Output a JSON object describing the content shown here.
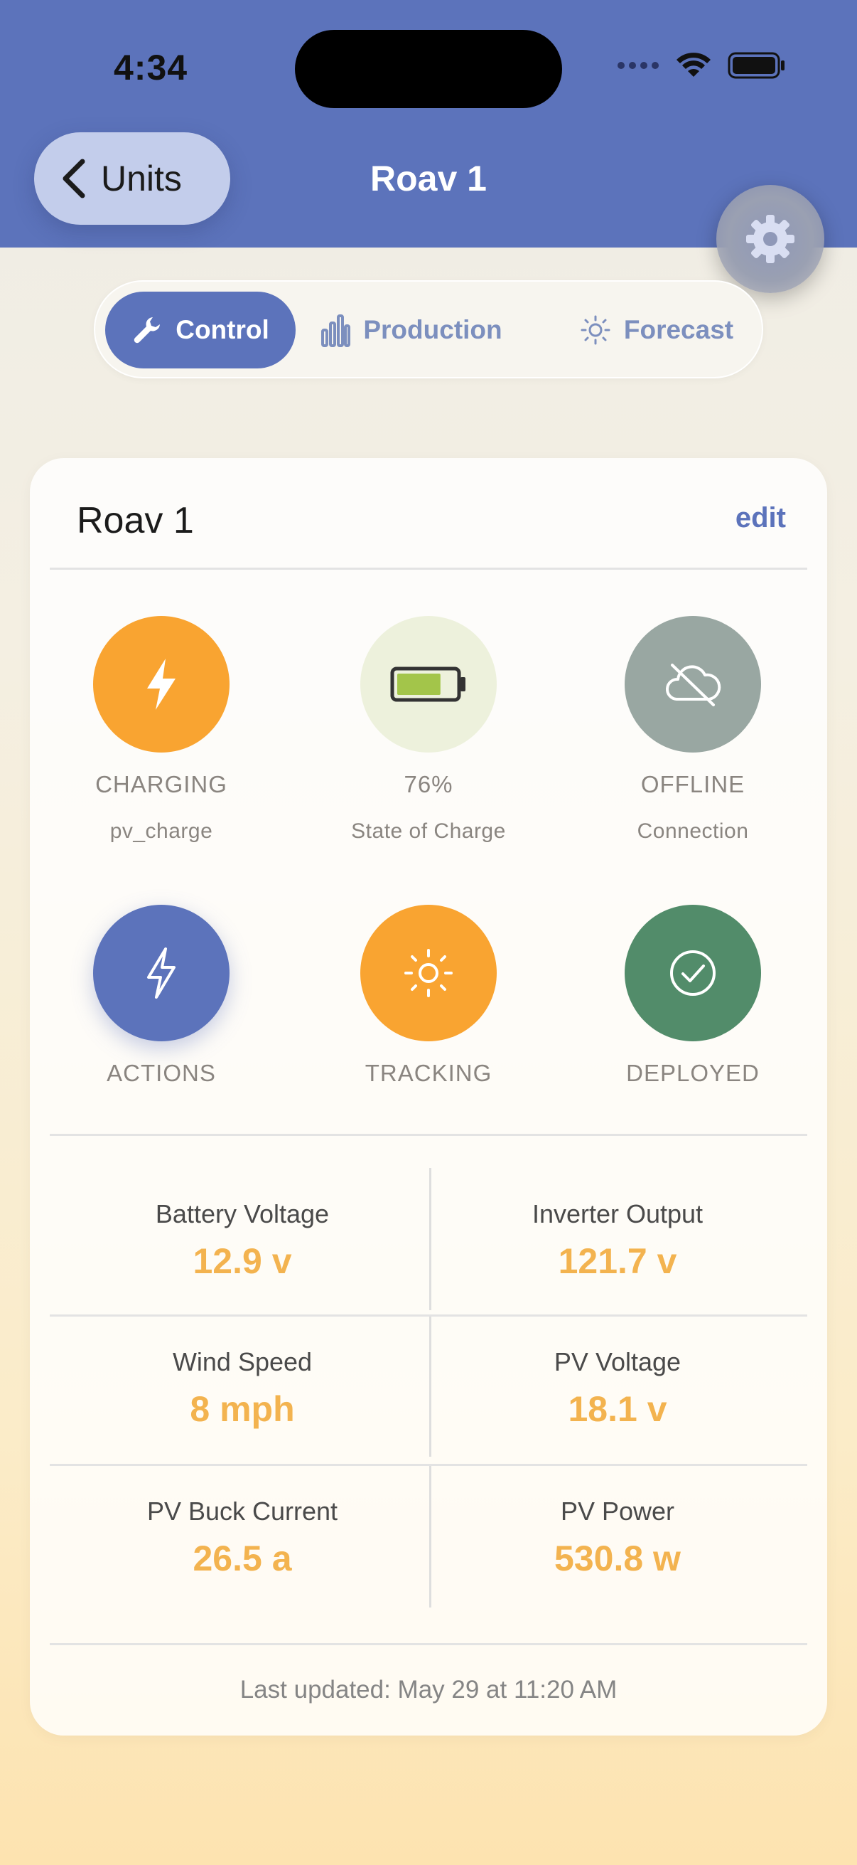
{
  "status_bar": {
    "time": "4:34"
  },
  "nav": {
    "back_label": "Units",
    "title": "Roav 1"
  },
  "tabs": [
    {
      "label": "Control",
      "icon": "wrench-icon",
      "active": true
    },
    {
      "label": "Production",
      "icon": "bar-chart-icon",
      "active": false
    },
    {
      "label": "Forecast",
      "icon": "sun-icon",
      "active": false
    }
  ],
  "card": {
    "title": "Roav 1",
    "edit_label": "edit",
    "status_items": [
      {
        "label": "CHARGING",
        "sub": "pv_charge",
        "icon": "bolt-icon",
        "color": "#f9a431"
      },
      {
        "label": "76%",
        "sub": "State of Charge",
        "icon": "battery-icon",
        "color": "#edf1dc",
        "level": 0.76
      },
      {
        "label": "OFFLINE",
        "sub": "Connection",
        "icon": "cloud-offline-icon",
        "color": "#99a7a2"
      },
      {
        "label": "ACTIONS",
        "icon": "bolt-outline-icon",
        "color": "#5c73bb"
      },
      {
        "label": "TRACKING",
        "icon": "sun-icon",
        "color": "#f9a431"
      },
      {
        "label": "DEPLOYED",
        "icon": "check-circle-icon",
        "color": "#528c6a"
      }
    ],
    "metrics": [
      {
        "label": "Battery Voltage",
        "value": "12.9 v"
      },
      {
        "label": "Inverter Output",
        "value": "121.7 v"
      },
      {
        "label": "Wind Speed",
        "value": "8 mph"
      },
      {
        "label": "PV Voltage",
        "value": "18.1 v"
      },
      {
        "label": "PV Buck Current",
        "value": "26.5 a"
      },
      {
        "label": "PV Power",
        "value": "530.8 w"
      }
    ],
    "last_updated": "Last updated: May 29 at 11:20 AM"
  },
  "colors": {
    "header": "#5c73bb",
    "accent_value": "#f3b34f"
  }
}
